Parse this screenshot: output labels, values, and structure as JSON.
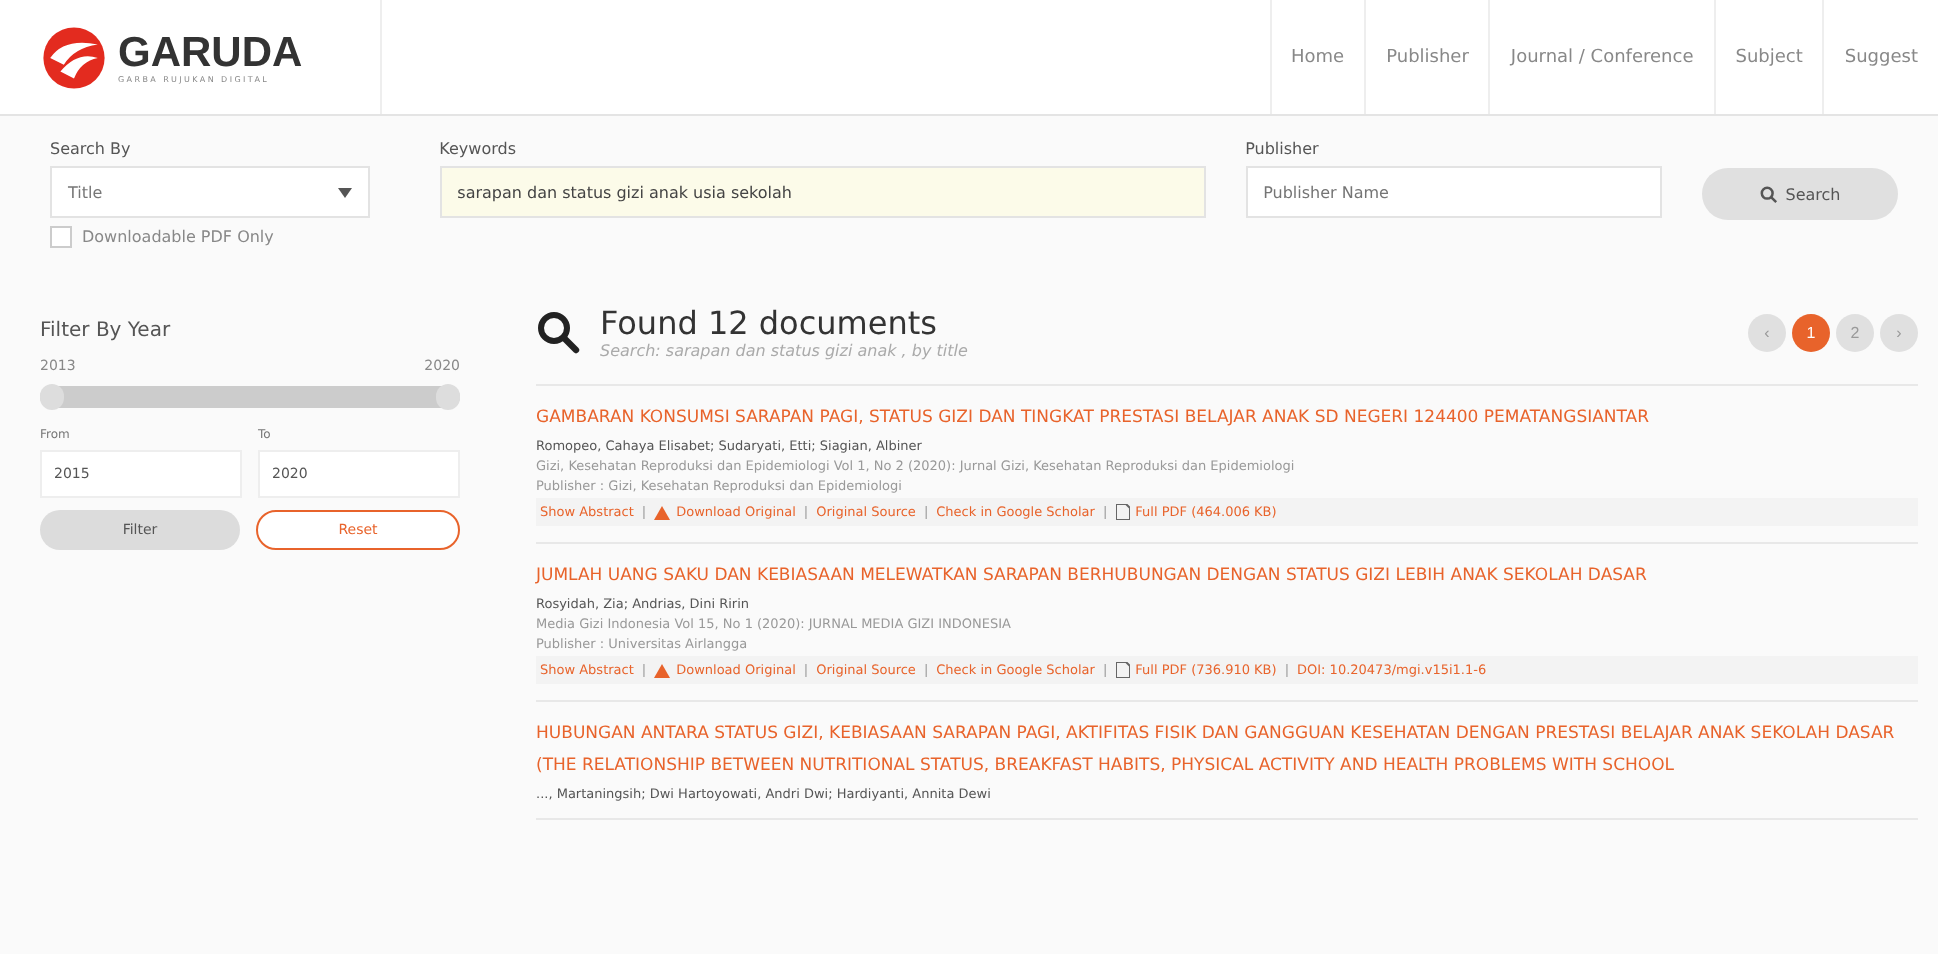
{
  "header": {
    "logo": "GARUDA",
    "tagline": "GARBA RUJUKAN DIGITAL",
    "nav": [
      {
        "label": "Home"
      },
      {
        "label": "Publisher"
      },
      {
        "label": "Journal / Conference"
      },
      {
        "label": "Subject"
      },
      {
        "label": "Suggest"
      }
    ]
  },
  "search": {
    "search_by_label": "Search By",
    "search_by_value": "Title",
    "keywords_label": "Keywords",
    "keywords_value": "sarapan dan status gizi anak usia sekolah",
    "publisher_label": "Publisher",
    "publisher_placeholder": "Publisher Name",
    "button": "Search",
    "pdf_only": {
      "label": "Downloadable PDF Only",
      "checked": false
    }
  },
  "filter": {
    "title": "Filter By Year",
    "min": "2013",
    "max": "2020",
    "level": 1,
    "from_label": "From",
    "to_label": "To",
    "from_value": "2015",
    "to_value": "2020",
    "filter_button": "Filter",
    "reset_button": "Reset"
  },
  "results": {
    "heading": "Found 12 documents",
    "subheading": "Search: sarapan dan status gizi anak , by title",
    "pages": [
      {
        "label": "‹",
        "selected": false
      },
      {
        "label": "1",
        "selected": true
      },
      {
        "label": "2",
        "selected": false
      },
      {
        "label": "›",
        "selected": false
      }
    ],
    "items": [
      {
        "title": "GAMBARAN KONSUMSI SARAPAN PAGI, STATUS GIZI DAN TINGKAT PRESTASI BELAJAR ANAK SD NEGERI 124400 PEMATANGSIANTAR",
        "authors": "Romopeo, Cahaya Elisabet; Sudaryati, Etti; Siagian, Albiner",
        "source": "Gizi, Kesehatan Reproduksi dan Epidemiologi Vol 1, No 2 (2020): Jurnal Gizi, Kesehatan Reproduksi dan Epidemiologi",
        "publisher": "Publisher : Gizi, Kesehatan Reproduksi dan Epidemiologi",
        "links": [
          {
            "kind": "link",
            "text": "Show Abstract"
          },
          {
            "kind": "sep",
            "text": "|"
          },
          {
            "kind": "download",
            "text": "Download Original"
          },
          {
            "kind": "sep",
            "text": "|"
          },
          {
            "kind": "link",
            "text": "Original Source"
          },
          {
            "kind": "sep",
            "text": "|"
          },
          {
            "kind": "link",
            "text": "Check in Google Scholar"
          },
          {
            "kind": "sep",
            "text": "|"
          },
          {
            "kind": "pdf",
            "text": "Full PDF (464.006 KB)"
          }
        ]
      },
      {
        "title": "JUMLAH UANG SAKU DAN KEBIASAAN MELEWATKAN SARAPAN BERHUBUNGAN DENGAN STATUS GIZI LEBIH ANAK SEKOLAH DASAR",
        "authors": "Rosyidah, Zia; Andrias, Dini Ririn",
        "source": "Media Gizi Indonesia Vol 15, No 1 (2020): JURNAL MEDIA GIZI INDONESIA",
        "publisher": "Publisher : Universitas Airlangga",
        "links": [
          {
            "kind": "link",
            "text": "Show Abstract"
          },
          {
            "kind": "sep",
            "text": "|"
          },
          {
            "kind": "download",
            "text": "Download Original"
          },
          {
            "kind": "sep",
            "text": "|"
          },
          {
            "kind": "link",
            "text": "Original Source"
          },
          {
            "kind": "sep",
            "text": "|"
          },
          {
            "kind": "link",
            "text": "Check in Google Scholar"
          },
          {
            "kind": "sep",
            "text": "|"
          },
          {
            "kind": "pdf",
            "text": "Full PDF (736.910 KB)"
          },
          {
            "kind": "sep",
            "text": "|"
          },
          {
            "kind": "link",
            "text": "DOI: 10.20473/mgi.v15i1.1-6"
          }
        ]
      },
      {
        "title": "HUBUNGAN ANTARA STATUS GIZI, KEBIASAAN SARAPAN PAGI, AKTIFITAS FISIK DAN GANGGUAN KESEHATAN DENGAN PRESTASI BELAJAR ANAK SEKOLAH DASAR (THE RELATIONSHIP BETWEEN NUTRITIONAL STATUS, BREAKFAST HABITS, PHYSICAL ACTIVITY AND HEALTH PROBLEMS WITH SCHOOL",
        "authors": "..., Martaningsih; Dwi Hartoyowati, Andri Dwi; Hardiyanti, Annita Dewi"
      }
    ]
  }
}
